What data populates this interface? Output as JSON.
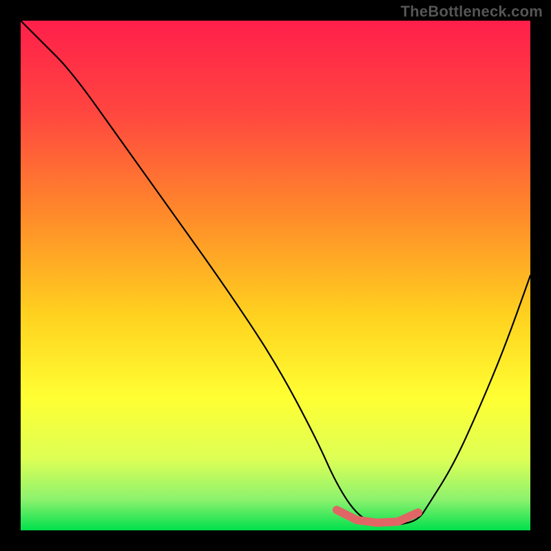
{
  "watermark": "TheBottleneck.com",
  "chart_data": {
    "type": "line",
    "title": "",
    "xlabel": "",
    "ylabel": "",
    "xlim": [
      0,
      100
    ],
    "ylim": [
      0,
      100
    ],
    "grid": false,
    "legend": false,
    "background_gradient_stops": [
      {
        "offset": 0.0,
        "color": "#ff1f4a"
      },
      {
        "offset": 0.18,
        "color": "#ff4640"
      },
      {
        "offset": 0.38,
        "color": "#ff8a2a"
      },
      {
        "offset": 0.58,
        "color": "#ffd21f"
      },
      {
        "offset": 0.74,
        "color": "#ffff33"
      },
      {
        "offset": 0.86,
        "color": "#ddff55"
      },
      {
        "offset": 0.94,
        "color": "#8cf26e"
      },
      {
        "offset": 1.0,
        "color": "#00e04c"
      }
    ],
    "series": [
      {
        "name": "curve",
        "x": [
          0,
          4,
          10,
          20,
          30,
          40,
          50,
          58,
          62,
          66,
          70,
          74,
          78,
          80,
          85,
          90,
          95,
          100
        ],
        "values": [
          100,
          96,
          90,
          76,
          62,
          48,
          33,
          18,
          9,
          3,
          1,
          1,
          2,
          5,
          13,
          24,
          36,
          50
        ]
      }
    ],
    "highlight_segment": {
      "name": "flat-bottom",
      "color": "#e06666",
      "points_x": [
        62,
        66,
        70,
        74,
        78
      ],
      "points_y": [
        4.0,
        2.0,
        1.5,
        1.7,
        3.5
      ]
    }
  }
}
